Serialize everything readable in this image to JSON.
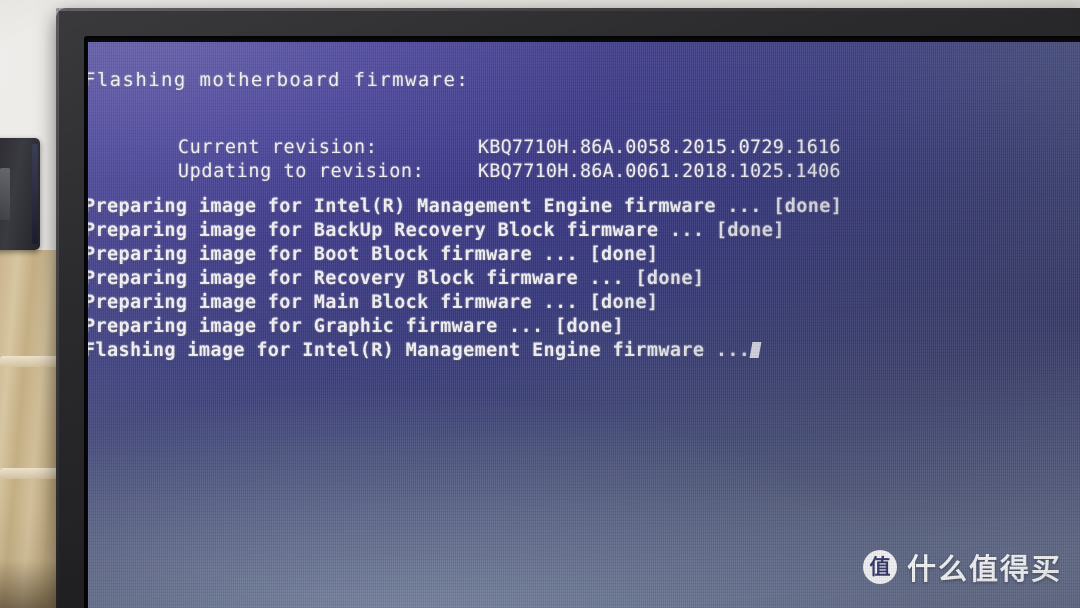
{
  "screen": {
    "title": "Flashing motherboard firmware:",
    "revisions": [
      {
        "label": "Current revision:",
        "value": "KBQ7710H.86A.0058.2015.0729.1616"
      },
      {
        "label": "Updating to revision:",
        "value": "KBQ7710H.86A.0061.2018.1025.1406"
      }
    ],
    "log_lines": [
      "Preparing image for Intel(R) Management Engine firmware ... [done]",
      "Preparing image for BackUp Recovery Block firmware ... [done]",
      "Preparing image for Boot Block firmware ... [done]",
      "Preparing image for Recovery Block firmware ... [done]",
      "Preparing image for Main Block firmware ... [done]",
      "Preparing image for Graphic firmware ... [done]",
      "Flashing image for Intel(R) Management Engine firmware ..."
    ],
    "colors": {
      "text": "#f3f2f7",
      "background_top_left": "#4a44a0",
      "background_bottom": "#667089",
      "bezel": "#2b2b2d"
    }
  },
  "watermark": {
    "logo_glyph": "值",
    "text": "什么值得买"
  }
}
